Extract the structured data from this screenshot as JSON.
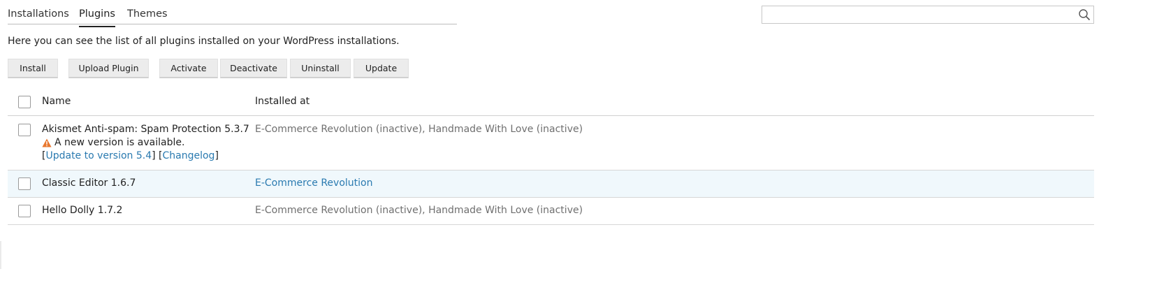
{
  "tabs": [
    {
      "label": "Installations"
    },
    {
      "label": "Plugins"
    },
    {
      "label": "Themes"
    }
  ],
  "search": {
    "value": "",
    "placeholder": "",
    "icon": "search-icon"
  },
  "intro": "Here you can see the list of all plugins installed on your WordPress installations.",
  "toolbar": {
    "install": "Install",
    "upload": "Upload Plugin",
    "activate": "Activate",
    "deactivate": "Deactivate",
    "uninstall": "Uninstall",
    "update": "Update"
  },
  "table": {
    "columns": {
      "name": "Name",
      "installed_at": "Installed at"
    },
    "rows": [
      {
        "name": "Akismet Anti-spam: Spam Protection 5.3.7",
        "notice": "A new version is available.",
        "update_link": "Update to version 5.4",
        "changelog_link": "Changelog",
        "installed_at": "E-Commerce Revolution (inactive), Handmade With Love (inactive)"
      },
      {
        "name": "Classic Editor 1.6.7",
        "installed_at": "E-Commerce Revolution"
      },
      {
        "name": "Hello Dolly 1.7.2",
        "installed_at": "E-Commerce Revolution (inactive), Handmade With Love (inactive)"
      }
    ]
  },
  "colors": {
    "link": "#2a7ab0",
    "warning": "#e8772e",
    "row_highlight": "#f0f8fc"
  }
}
